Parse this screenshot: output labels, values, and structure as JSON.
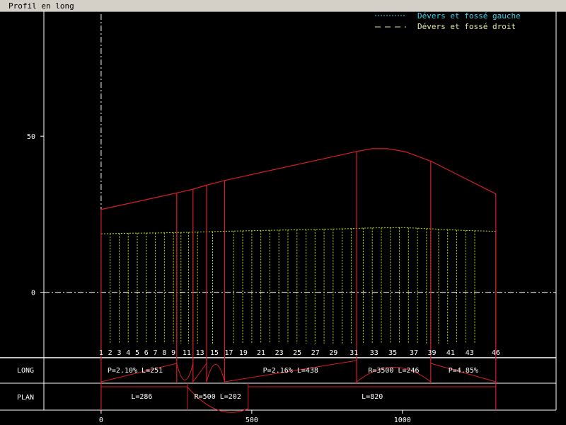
{
  "window": {
    "title": "Profil en long"
  },
  "colors": {
    "profile": "#d41f2a",
    "terrain": "#b8e600",
    "frame": "#ffffff",
    "legend_left": "#3fd0e8",
    "legend_right": "#e6e8a0",
    "axis_text": "#ffffff"
  },
  "legend": {
    "left_label": "Dévers et fossé gauche",
    "right_label": "Dévers et fossé droit"
  },
  "chart_data": {
    "type": "line",
    "xlim": [
      -190,
      1510
    ],
    "ylim": [
      -21,
      90
    ],
    "x_ticks": [
      0,
      500,
      1000
    ],
    "y_ticks": [
      0,
      50
    ],
    "grid": false,
    "legend_position": "top-right",
    "series": [
      {
        "points": [
          [
            0,
            26.5
          ],
          [
            251,
            31.8
          ],
          [
            305,
            33.0
          ],
          [
            350,
            34.3
          ],
          [
            410,
            35.8
          ],
          [
            848,
            45.1
          ],
          [
            900,
            46.0
          ],
          [
            950,
            46.0
          ],
          [
            1010,
            45.0
          ],
          [
            1094,
            42.0
          ],
          [
            1310,
            31.5
          ]
        ]
      },
      {
        "points": [
          [
            0,
            18.7
          ],
          [
            100,
            18.9
          ],
          [
            200,
            19.0
          ],
          [
            300,
            19.2
          ],
          [
            400,
            19.5
          ],
          [
            500,
            19.7
          ],
          [
            600,
            19.9
          ],
          [
            700,
            20.1
          ],
          [
            800,
            20.3
          ],
          [
            900,
            20.6
          ],
          [
            1000,
            20.7
          ],
          [
            1100,
            20.3
          ],
          [
            1200,
            19.8
          ],
          [
            1310,
            19.5
          ]
        ]
      }
    ],
    "stations": {
      "x": [
        0,
        30,
        60,
        90,
        120,
        150,
        180,
        210,
        240,
        251,
        265,
        290,
        305,
        320,
        350,
        370,
        410,
        440,
        470,
        500,
        530,
        560,
        590,
        620,
        650,
        680,
        710,
        740,
        770,
        800,
        830,
        848,
        870,
        900,
        930,
        960,
        990,
        1020,
        1050,
        1080,
        1094,
        1120,
        1150,
        1180,
        1210,
        1240,
        1310
      ],
      "labels": [
        "1",
        "2",
        "3",
        "4",
        "5",
        "6",
        "7",
        "8",
        "9",
        "11",
        "13",
        "15",
        "17",
        "19",
        "21",
        "23",
        "25",
        "27",
        "29",
        "31",
        "33",
        "35",
        "37",
        "39",
        "41",
        "43",
        "46"
      ],
      "label_x": [
        0,
        30,
        60,
        90,
        120,
        150,
        180,
        210,
        240,
        284,
        328,
        376,
        424,
        472,
        531,
        591,
        651,
        711,
        771,
        839,
        906,
        968,
        1038,
        1098,
        1160,
        1223,
        1310
      ]
    },
    "vertical_markers_x": [
      251,
      305,
      350,
      410,
      848,
      1094
    ],
    "long_band": {
      "label": "LONG",
      "segments": [
        {
          "text": "P=2.10% L=251",
          "x": 113
        },
        {
          "text": "P=2.16% L=438",
          "x": 629
        },
        {
          "text": "R=3500 L=246",
          "x": 971
        },
        {
          "text": "P=4.85%",
          "x": 1202
        }
      ],
      "dividers_x": [
        251,
        305,
        350,
        410,
        848,
        1094
      ]
    },
    "plan_band": {
      "label": "PLAN",
      "segments": [
        {
          "text": "L=286",
          "x": 135
        },
        {
          "text": "R=500 L=202",
          "x": 387
        },
        {
          "text": "L=820",
          "x": 900
        }
      ],
      "dividers_x": [
        286,
        488
      ]
    }
  }
}
